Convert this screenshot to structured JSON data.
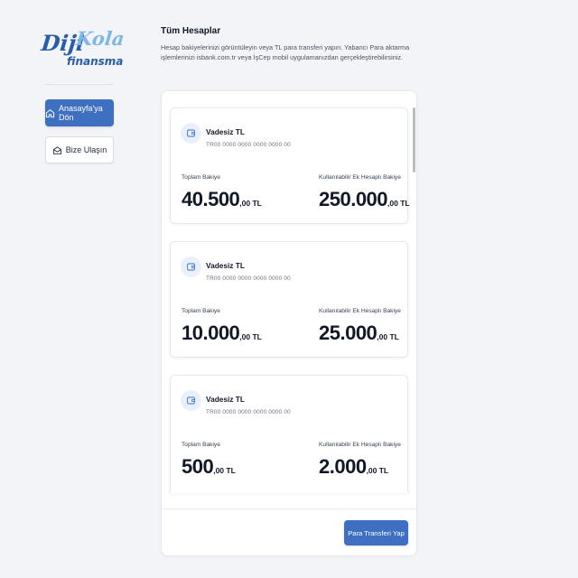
{
  "brand": {
    "logo_line1": "DijiKolay",
    "logo_line2": "finansman"
  },
  "sidebar": {
    "home_button": "Anasayfa'ya Dön",
    "contact_button": "Bize Ulaşın"
  },
  "header": {
    "title": "Tüm Hesaplar",
    "description": "Hesap bakiyelerinizi görüntüleyin veya TL para transferi yapın. Yabancı Para aktarma işlemlerinizi isbank.com.tr veya İşCep mobil uygulamanızdan gerçekleştirebilirsiniz."
  },
  "accounts": [
    {
      "name": "Vadesiz TL",
      "iban": "TR00 0000 0000 0000 0000 00",
      "balance_label": "Toplam Bakiye",
      "balance_int": "40.500",
      "balance_dec": ",00 TL",
      "credit_label": "Kullanılabilir Ek Hesaplı Bakiye",
      "credit_int": "250.000",
      "credit_dec": ",00 TL"
    },
    {
      "name": "Vadesiz TL",
      "iban": "TR00 0000 0000 0000 0000 00",
      "balance_label": "Toplam Bakiye",
      "balance_int": "10.000",
      "balance_dec": ",00 TL",
      "credit_label": "Kullanılabilir Ek Hesaplı Bakiye",
      "credit_int": "25.000",
      "credit_dec": ",00 TL"
    },
    {
      "name": "Vadesiz TL",
      "iban": "TR00 0000 0000 0000 0000 00",
      "balance_label": "Toplam Bakiye",
      "balance_int": "500",
      "balance_dec": ",00 TL",
      "credit_label": "Kullanılabilir Ek Hesaplı Bakiye",
      "credit_int": "2.000",
      "credit_dec": ",00 TL"
    }
  ],
  "footer": {
    "transfer_button": "Para Transferi Yap"
  },
  "colors": {
    "primary": "#3f6fc0",
    "logo_blue": "#2b5ca8",
    "logo_light": "#7fb7e6",
    "background": "#f3f4f7"
  },
  "icons": [
    "home-icon",
    "mail-icon",
    "wallet-icon"
  ]
}
